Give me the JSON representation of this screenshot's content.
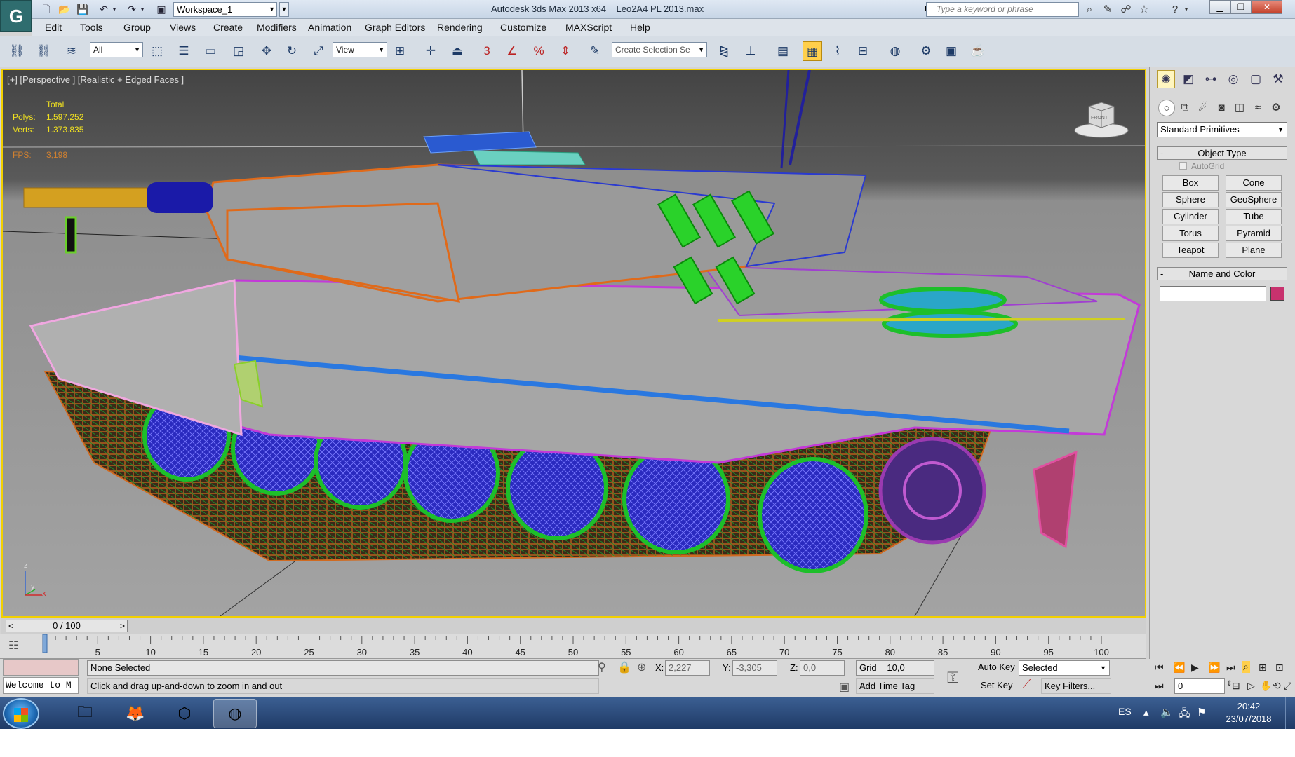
{
  "titlebar": {
    "workspace": "Workspace_1",
    "app_title": "Autodesk 3ds Max  2013 x64",
    "file_title": "Leo2A4 PL 2013.max",
    "search_placeholder": "Type a keyword or phrase"
  },
  "menu": [
    "Edit",
    "Tools",
    "Group",
    "Views",
    "Create",
    "Modifiers",
    "Animation",
    "Graph Editors",
    "Rendering",
    "Customize",
    "MAXScript",
    "Help"
  ],
  "toolbar": {
    "selection_filter": "All",
    "reference_coord": "View",
    "named_selection": "Create Selection Se"
  },
  "viewport": {
    "label": "[+] [Perspective ] [Realistic + Edged Faces ]",
    "stats": {
      "total_label": "Total",
      "polys_label": "Polys:",
      "polys_value": "1.597.252",
      "verts_label": "Verts:",
      "verts_value": "1.373.835",
      "fps_label": "FPS:",
      "fps_value": "3,198"
    },
    "viewcube_label": "FRONT",
    "axis_z": "z",
    "axis_y": "y",
    "axis_x": "x"
  },
  "command_panel": {
    "category": "Standard Primitives",
    "object_type_title": "Object Type",
    "autogrid_label": "AutoGrid",
    "primitives": [
      "Box",
      "Cone",
      "Sphere",
      "GeoSphere",
      "Cylinder",
      "Tube",
      "Torus",
      "Pyramid",
      "Teapot",
      "Plane"
    ],
    "name_color_title": "Name and Color",
    "object_color": "#c8326e"
  },
  "timeline": {
    "slider_text": "0 / 100",
    "ticks": [
      "5",
      "10",
      "15",
      "20",
      "25",
      "30",
      "35",
      "40",
      "45",
      "50",
      "55",
      "60",
      "65",
      "70",
      "75",
      "80",
      "85",
      "90",
      "95",
      "100"
    ]
  },
  "status": {
    "maxscript_text": "Welcome to M",
    "selection": "None Selected",
    "prompt": "Click and drag up-and-down to zoom in and out",
    "x_label": "X:",
    "x_value": "2,227",
    "y_label": "Y:",
    "y_value": "-3,305",
    "z_label": "Z:",
    "z_value": "0,0",
    "grid": "Grid = 10,0",
    "add_time_tag": "Add Time Tag",
    "auto_key": "Auto Key",
    "set_key": "Set Key",
    "selected_set": "Selected",
    "key_filters": "Key Filters...",
    "current_frame": "0"
  },
  "taskbar": {
    "language": "ES",
    "time": "20:42",
    "date": "23/07/2018"
  }
}
